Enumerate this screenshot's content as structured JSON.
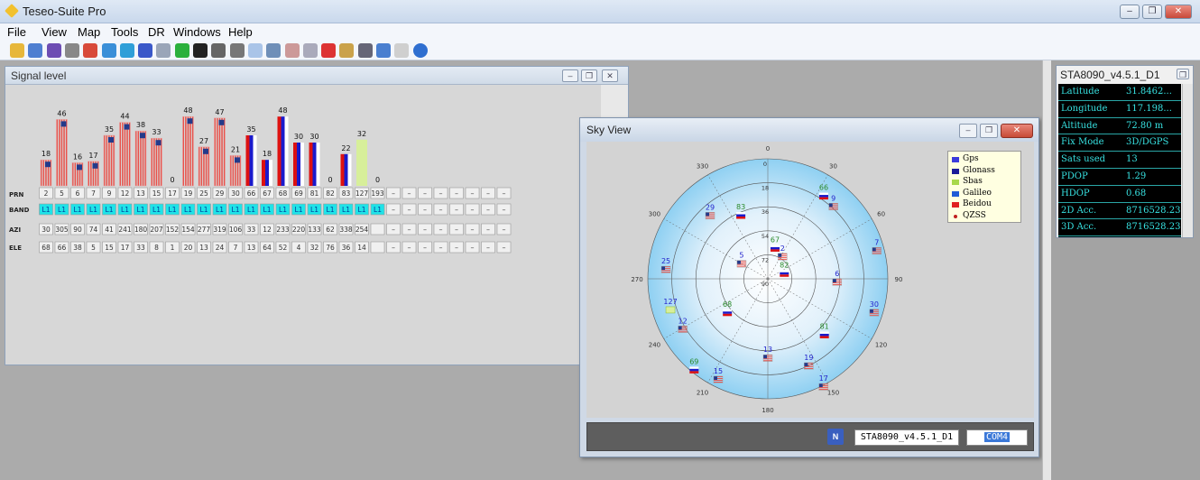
{
  "app_title": "Teseo-Suite Pro",
  "window_buttons": {
    "minimize": "–",
    "restore": "❐",
    "close": "✕"
  },
  "menu": [
    "File",
    "View",
    "Map",
    "Tools",
    "DR",
    "Windows",
    "Help"
  ],
  "toolbar_icons": [
    "edit-icon",
    "search-icon",
    "eye-icon",
    "eye-gray-icon",
    "pin-icon",
    "chart-icon",
    "globe-icon",
    "nmea-icon",
    "nmea-gray-icon",
    "play-icon",
    "terminal-icon",
    "disk-icon",
    "disk-gray-icon",
    "grid-icon",
    "window-icon",
    "thermometer-icon",
    "thermometer-gray-icon",
    "thermometer-red-icon",
    "satellite-icon",
    "antenna-icon",
    "signal-icon",
    "document-icon",
    "info-icon"
  ],
  "signal_level": {
    "title": "Signal level",
    "row_labels": [
      "PRN",
      "BAND",
      "AZI",
      "ELE"
    ],
    "prn": [
      "2",
      "5",
      "6",
      "7",
      "9",
      "12",
      "13",
      "15",
      "17",
      "19",
      "25",
      "29",
      "30",
      "66",
      "67",
      "68",
      "69",
      "81",
      "82",
      "83",
      "127",
      "193"
    ],
    "snr": [
      18,
      46,
      16,
      17,
      35,
      44,
      38,
      33,
      0,
      48,
      27,
      47,
      21,
      35,
      18,
      48,
      30,
      30,
      0,
      22,
      32,
      0
    ],
    "constellation": [
      "gps",
      "gps",
      "gps",
      "gps",
      "gps",
      "gps",
      "gps",
      "gps",
      "gps",
      "gps",
      "gps",
      "gps",
      "gps",
      "glonass",
      "glonass",
      "glonass",
      "glonass",
      "glonass",
      "glonass",
      "glonass",
      "sbas",
      "gps"
    ],
    "band": "L1",
    "azi": [
      "30",
      "305",
      "90",
      "74",
      "41",
      "241",
      "180",
      "207",
      "152",
      "154",
      "277",
      "319",
      "106",
      "33",
      "12",
      "233",
      "220",
      "133",
      "62",
      "338",
      "254",
      ""
    ],
    "ele": [
      "68",
      "66",
      "38",
      "5",
      "15",
      "17",
      "33",
      "8",
      "1",
      "20",
      "13",
      "24",
      "7",
      "13",
      "64",
      "52",
      "4",
      "32",
      "76",
      "36",
      "14",
      ""
    ],
    "empty_placeholder": "–",
    "empty_columns": 8
  },
  "sky_view": {
    "title": "Sky View",
    "elevation_labels": [
      "0",
      "18",
      "36",
      "54",
      "72",
      "90"
    ],
    "azimuth_labels": [
      "0",
      "30",
      "60",
      "90",
      "120",
      "150",
      "180",
      "210",
      "240",
      "270",
      "300",
      "330"
    ],
    "legend": [
      {
        "label": "Gps",
        "color": "#3b3bdb"
      },
      {
        "label": "Glonass",
        "color": "#1b1b99"
      },
      {
        "label": "Sbas",
        "color": "#a8d84a"
      },
      {
        "label": "Galileo",
        "color": "#1f5bd6"
      },
      {
        "label": "Beidou",
        "color": "#e02020"
      },
      {
        "label": "QZSS",
        "color": "#c02020"
      }
    ],
    "satellites": [
      {
        "prn": "66",
        "az": 33,
        "el": 13,
        "type": "glonass"
      },
      {
        "prn": "9",
        "az": 41,
        "el": 15,
        "type": "gps"
      },
      {
        "prn": "29",
        "az": 319,
        "el": 24,
        "type": "gps"
      },
      {
        "prn": "83",
        "az": 338,
        "el": 36,
        "type": "glonass"
      },
      {
        "prn": "7",
        "az": 74,
        "el": 5,
        "type": "gps"
      },
      {
        "prn": "67",
        "az": 12,
        "el": 64,
        "type": "glonass"
      },
      {
        "prn": "5",
        "az": 305,
        "el": 66,
        "type": "gps"
      },
      {
        "prn": "2",
        "az": 30,
        "el": 68,
        "type": "gps"
      },
      {
        "prn": "82",
        "az": 62,
        "el": 76,
        "type": "glonass"
      },
      {
        "prn": "6",
        "az": 90,
        "el": 38,
        "type": "gps"
      },
      {
        "prn": "25",
        "az": 277,
        "el": 13,
        "type": "gps"
      },
      {
        "prn": "127",
        "az": 254,
        "el": 14,
        "type": "sbas"
      },
      {
        "prn": "12",
        "az": 241,
        "el": 17,
        "type": "gps"
      },
      {
        "prn": "68",
        "az": 233,
        "el": 52,
        "type": "glonass"
      },
      {
        "prn": "30",
        "az": 106,
        "el": 7,
        "type": "gps"
      },
      {
        "prn": "81",
        "az": 133,
        "el": 32,
        "type": "glonass"
      },
      {
        "prn": "13",
        "az": 180,
        "el": 33,
        "type": "gps"
      },
      {
        "prn": "19",
        "az": 154,
        "el": 20,
        "type": "gps"
      },
      {
        "prn": "17",
        "az": 152,
        "el": 1,
        "type": "gps"
      },
      {
        "prn": "69",
        "az": 220,
        "el": 4,
        "type": "glonass"
      },
      {
        "prn": "15",
        "az": 207,
        "el": 8,
        "type": "gps"
      }
    ],
    "status_device": "STA8090_v4.5.1_D1",
    "status_port": "COM4",
    "status_logo": "N"
  },
  "info_panel": {
    "title": "STA8090_v4.5.1_D1",
    "rows": [
      {
        "key": "Latitude",
        "value": "31.8462..."
      },
      {
        "key": "Longitude",
        "value": "117.198..."
      },
      {
        "key": "Altitude",
        "value": "72.80 m"
      },
      {
        "key": "Fix Mode",
        "value": "3D/DGPS"
      },
      {
        "key": "Sats used",
        "value": "13"
      },
      {
        "key": "PDOP",
        "value": "1.29"
      },
      {
        "key": "HDOP",
        "value": "0.68"
      },
      {
        "key": "2D Acc.",
        "value": "8716528.23"
      },
      {
        "key": "3D Acc.",
        "value": "8716528.23"
      }
    ]
  },
  "colors": {
    "gps_red": "#e8514a",
    "gps_blue": "#243a8a",
    "glonass_blue": "#1a1acc",
    "glonass_red": "#dd1111",
    "sbas": "#d7ef9a",
    "band_cell": "#1fe3e8",
    "info_bg": "#000000",
    "info_text": "#37e0e0"
  }
}
